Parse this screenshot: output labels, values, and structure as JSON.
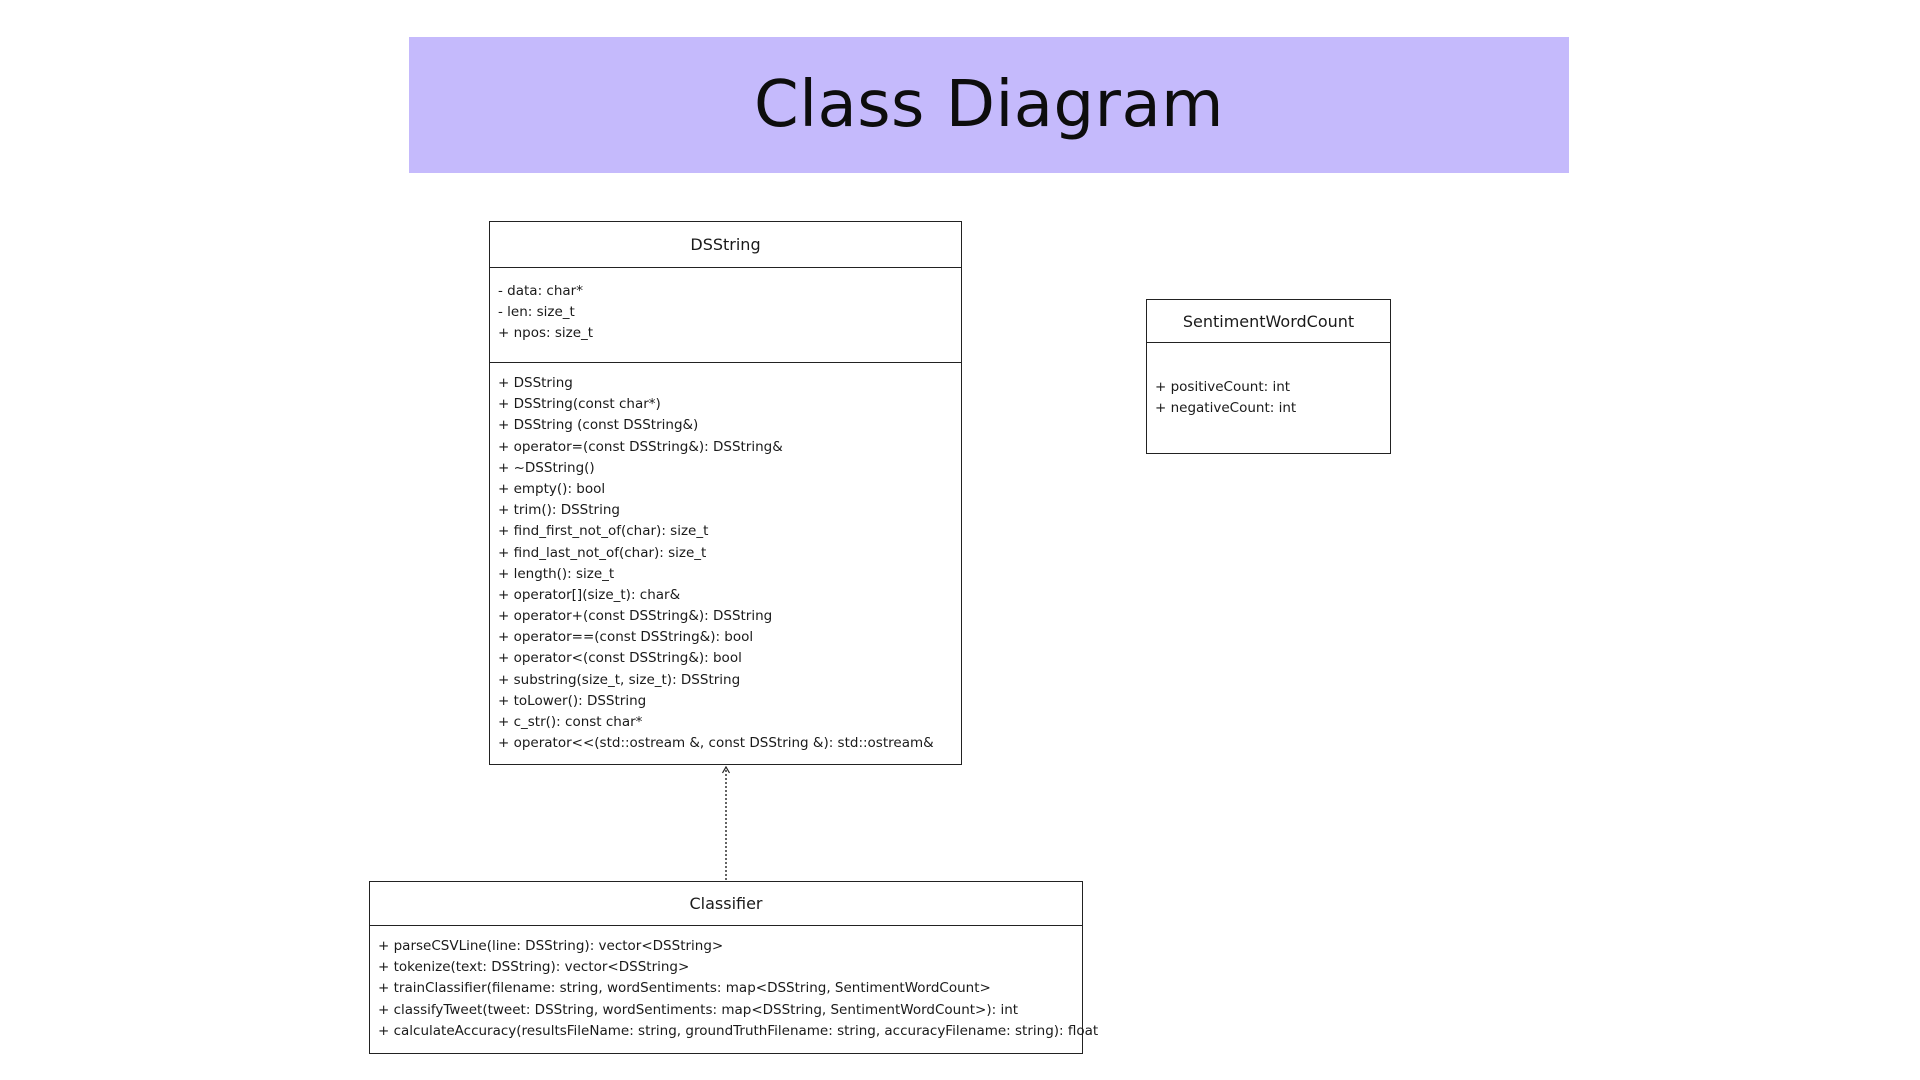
{
  "title": "Class Diagram",
  "colors": {
    "banner": "#c5bafc",
    "border": "#222222"
  },
  "classes": {
    "dsstring": {
      "name": "DSString",
      "attributes": [
        "- data: char*",
        "- len: size_t",
        "+ npos: size_t"
      ],
      "methods": [
        "+ DSString",
        "+ DSString(const char*)",
        "+ DSString (const DSString&)",
        "+ operator=(const DSString&): DSString&",
        "+ ~DSString()",
        "+ empty(): bool",
        "+ trim(): DSString",
        "+ find_first_not_of(char): size_t",
        "+ find_last_not_of(char): size_t",
        "+ length(): size_t",
        "+ operator[](size_t): char&",
        "+ operator+(const DSString&): DSString",
        "+ operator==(const DSString&): bool",
        "+ operator<(const DSString&): bool",
        "+ substring(size_t, size_t): DSString",
        "+ toLower(): DSString",
        "+ c_str(): const char*",
        "+ operator<<(std::ostream &, const DSString &): std::ostream&"
      ]
    },
    "sentiment": {
      "name": "SentimentWordCount",
      "attributes": [
        "+ positiveCount: int",
        "+ negativeCount: int"
      ]
    },
    "classifier": {
      "name": "Classifier",
      "methods": [
        "+ parseCSVLine(line: DSString): vector<DSString>",
        "+ tokenize(text: DSString): vector<DSString>",
        "+ trainClassifier(filename: string, wordSentiments: map<DSString, SentimentWordCount>",
        "+ classifyTweet(tweet: DSString, wordSentiments: map<DSString, SentimentWordCount>): int",
        "+ calculateAccuracy(resultsFileName: string, groundTruthFilename: string, accuracyFilename: string): float"
      ]
    }
  }
}
